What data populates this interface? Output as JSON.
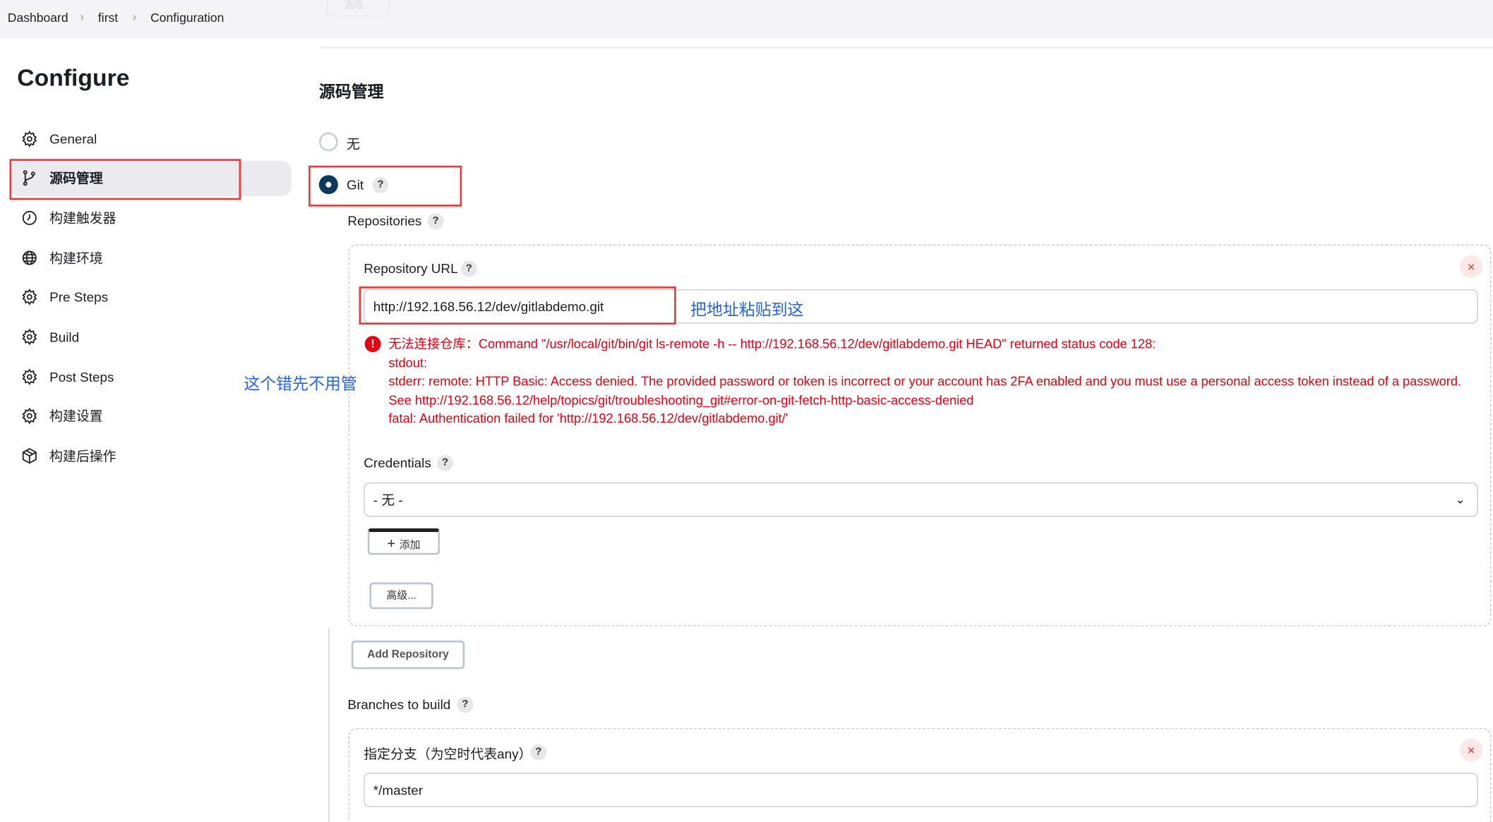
{
  "breadcrumb": {
    "items": [
      "Dashboard",
      "first",
      "Configuration"
    ],
    "ghost_button": "高级..."
  },
  "sidebar": {
    "title": "Configure",
    "items": [
      {
        "label": "General",
        "icon": "gear-icon"
      },
      {
        "label": "源码管理",
        "icon": "git-branch-icon"
      },
      {
        "label": "构建触发器",
        "icon": "clock-icon"
      },
      {
        "label": "构建环境",
        "icon": "globe-icon"
      },
      {
        "label": "Pre Steps",
        "icon": "gear-icon"
      },
      {
        "label": "Build",
        "icon": "gear-icon"
      },
      {
        "label": "Post Steps",
        "icon": "gear-icon"
      },
      {
        "label": "构建设置",
        "icon": "gear-icon"
      },
      {
        "label": "构建后操作",
        "icon": "package-icon"
      }
    ]
  },
  "main": {
    "section_title": "源码管理",
    "scm_options": [
      {
        "label": "无",
        "selected": false
      },
      {
        "label": "Git",
        "selected": true
      }
    ],
    "repositories_label": "Repositories",
    "repo_url_label": "Repository URL",
    "repo_url_value": "http://192.168.56.12/dev/gitlabdemo.git",
    "error_lines": [
      "无法连接仓库：Command \"/usr/local/git/bin/git ls-remote -h -- http://192.168.56.12/dev/gitlabdemo.git HEAD\" returned status code 128:",
      "stdout:",
      "stderr: remote: HTTP Basic: Access denied. The provided password or token is incorrect or your account has 2FA enabled and you must use a personal access token instead of a password.",
      "See http://192.168.56.12/help/topics/git/troubleshooting_git#error-on-git-fetch-http-basic-access-denied",
      "fatal: Authentication failed for 'http://192.168.56.12/dev/gitlabdemo.git/'"
    ],
    "credentials_label": "Credentials",
    "credentials_value": "- 无 -",
    "add_button": "添加",
    "advanced_button": "高级...",
    "add_repository_button": "Add Repository",
    "branches_label": "Branches to build",
    "branch_spec_label": "指定分支（为空时代表any）",
    "branch_spec_value": "*/master",
    "help_glyph": "?",
    "close_glyph": "×"
  },
  "annotations": {
    "paste_here": "把地址粘贴到这",
    "ignore_error": "这个错先不用管"
  },
  "colors": {
    "error": "#e60012",
    "annotation": "#2663e0",
    "highlight_box": "#f03a3a",
    "radio_selected": "#0b3a5c"
  }
}
